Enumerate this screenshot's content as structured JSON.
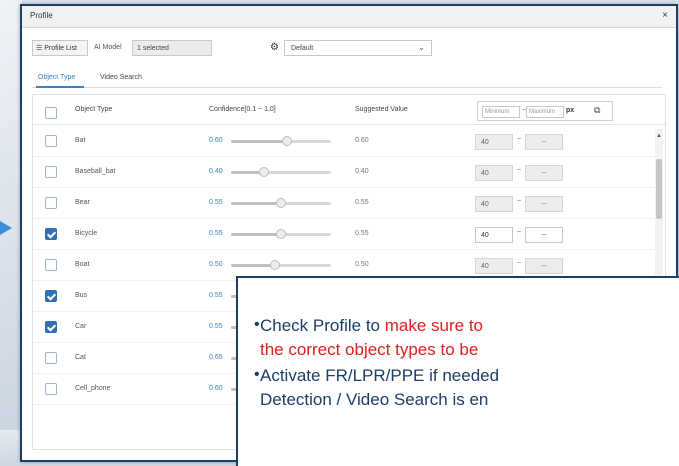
{
  "dialog": {
    "title": "Profile",
    "close": "×"
  },
  "toolbar": {
    "profile_list": "☰ Profile List",
    "ai_model_label": "AI Model",
    "ai_model_value": "1 selected",
    "profile_value": "Default"
  },
  "tabs": [
    {
      "label": "Object Type",
      "active": true
    },
    {
      "label": "Video Search",
      "active": false
    }
  ],
  "table": {
    "headers": {
      "object_type": "Object Type",
      "confidence": "Confidence[0.1 ~ 1.0]",
      "suggested": "Suggested Value",
      "min_placeholder": "Minimum",
      "max_placeholder": "Maximum",
      "unit": "px"
    },
    "rows": [
      {
        "name": "Bat",
        "confidence": "0.60",
        "suggested": "0.60",
        "checked": false,
        "min": "40",
        "max": "--"
      },
      {
        "name": "Baseball_bat",
        "confidence": "0.40",
        "suggested": "0.40",
        "checked": false,
        "min": "40",
        "max": "--"
      },
      {
        "name": "Bear",
        "confidence": "0.55",
        "suggested": "0.55",
        "checked": false,
        "min": "40",
        "max": "--"
      },
      {
        "name": "Bicycle",
        "confidence": "0.55",
        "suggested": "0.55",
        "checked": true,
        "min": "40",
        "max": "--"
      },
      {
        "name": "Boat",
        "confidence": "0.50",
        "suggested": "0.50",
        "checked": false,
        "min": "40",
        "max": "--"
      },
      {
        "name": "Bus",
        "confidence": "0.55",
        "checked": true
      },
      {
        "name": "Car",
        "confidence": "0.55",
        "checked": true
      },
      {
        "name": "Cat",
        "confidence": "0.65",
        "checked": false
      },
      {
        "name": "Cell_phone",
        "confidence": "0.60",
        "checked": false
      }
    ]
  },
  "callout": {
    "bullet1_a": "Check Profile to ",
    "bullet1_b": "make sure to",
    "bullet1_line2": "the correct object types to be",
    "bullet2_line1": "Activate FR/LPR/PPE if needed",
    "bullet2_line2": "Detection / Video Search is en"
  },
  "colors": {
    "accent": "#3b7fc4",
    "frame": "#1b3e68",
    "highlight": "#e02020",
    "checked": "#2f6fb2"
  }
}
